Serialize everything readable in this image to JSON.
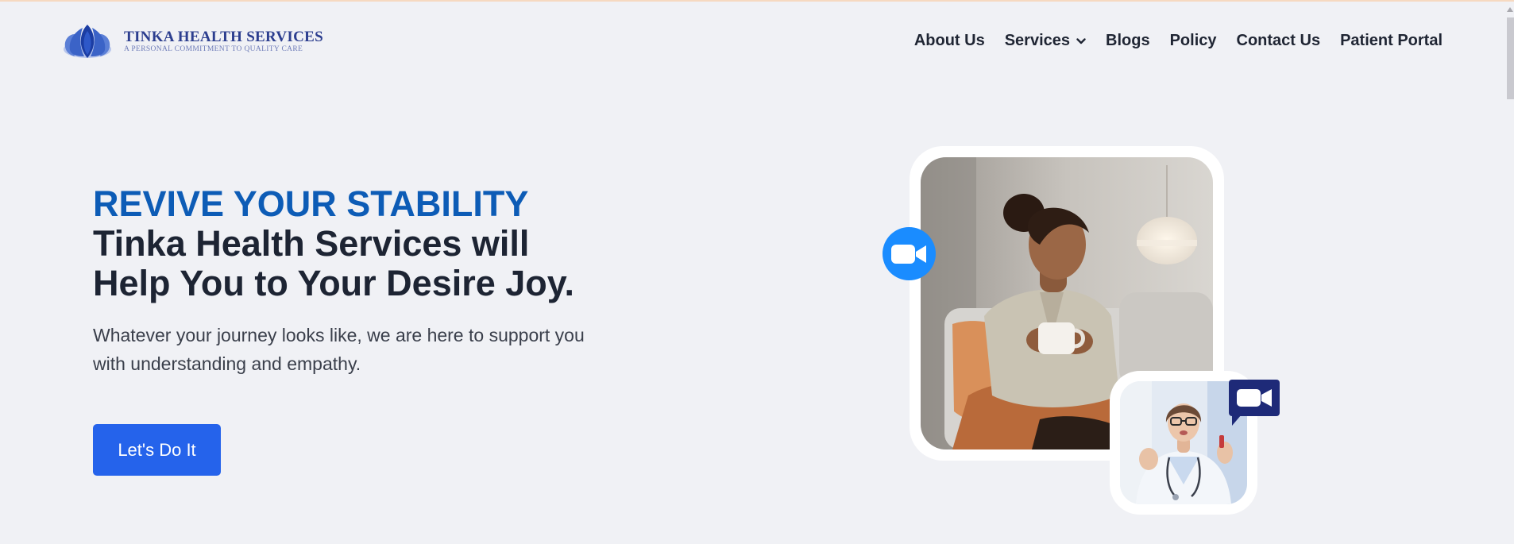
{
  "brand": {
    "name": "TINKA HEALTH SERVICES",
    "tagline": "A PERSONAL COMMITMENT TO QUALITY CARE",
    "logo_icon": "lotus-icon",
    "primary_color": "#2c3e8f"
  },
  "nav": {
    "items": [
      {
        "label": "About Us",
        "has_dropdown": false
      },
      {
        "label": "Services",
        "has_dropdown": true
      },
      {
        "label": "Blogs",
        "has_dropdown": false
      },
      {
        "label": "Policy",
        "has_dropdown": false
      },
      {
        "label": "Contact Us",
        "has_dropdown": false
      },
      {
        "label": "Patient Portal",
        "has_dropdown": false
      }
    ],
    "dropdown_icon": "chevron-down-icon"
  },
  "hero": {
    "eyebrow": "REVIVE YOUR STABILITY",
    "headline_line1": "Tinka Health Services will",
    "headline_line2": "Help You to Your Desire Joy.",
    "subtext_line1": "Whatever your journey looks like, we are here to support you",
    "subtext_line2": "with understanding and empathy.",
    "cta_label": "Let's Do It",
    "accent_color": "#0d5cb6",
    "cta_color": "#2563eb"
  },
  "media": {
    "video_call_icon": "video-camera-icon",
    "video_bubble_color": "#1a8cff",
    "video_badge_color": "#1e2a78"
  }
}
